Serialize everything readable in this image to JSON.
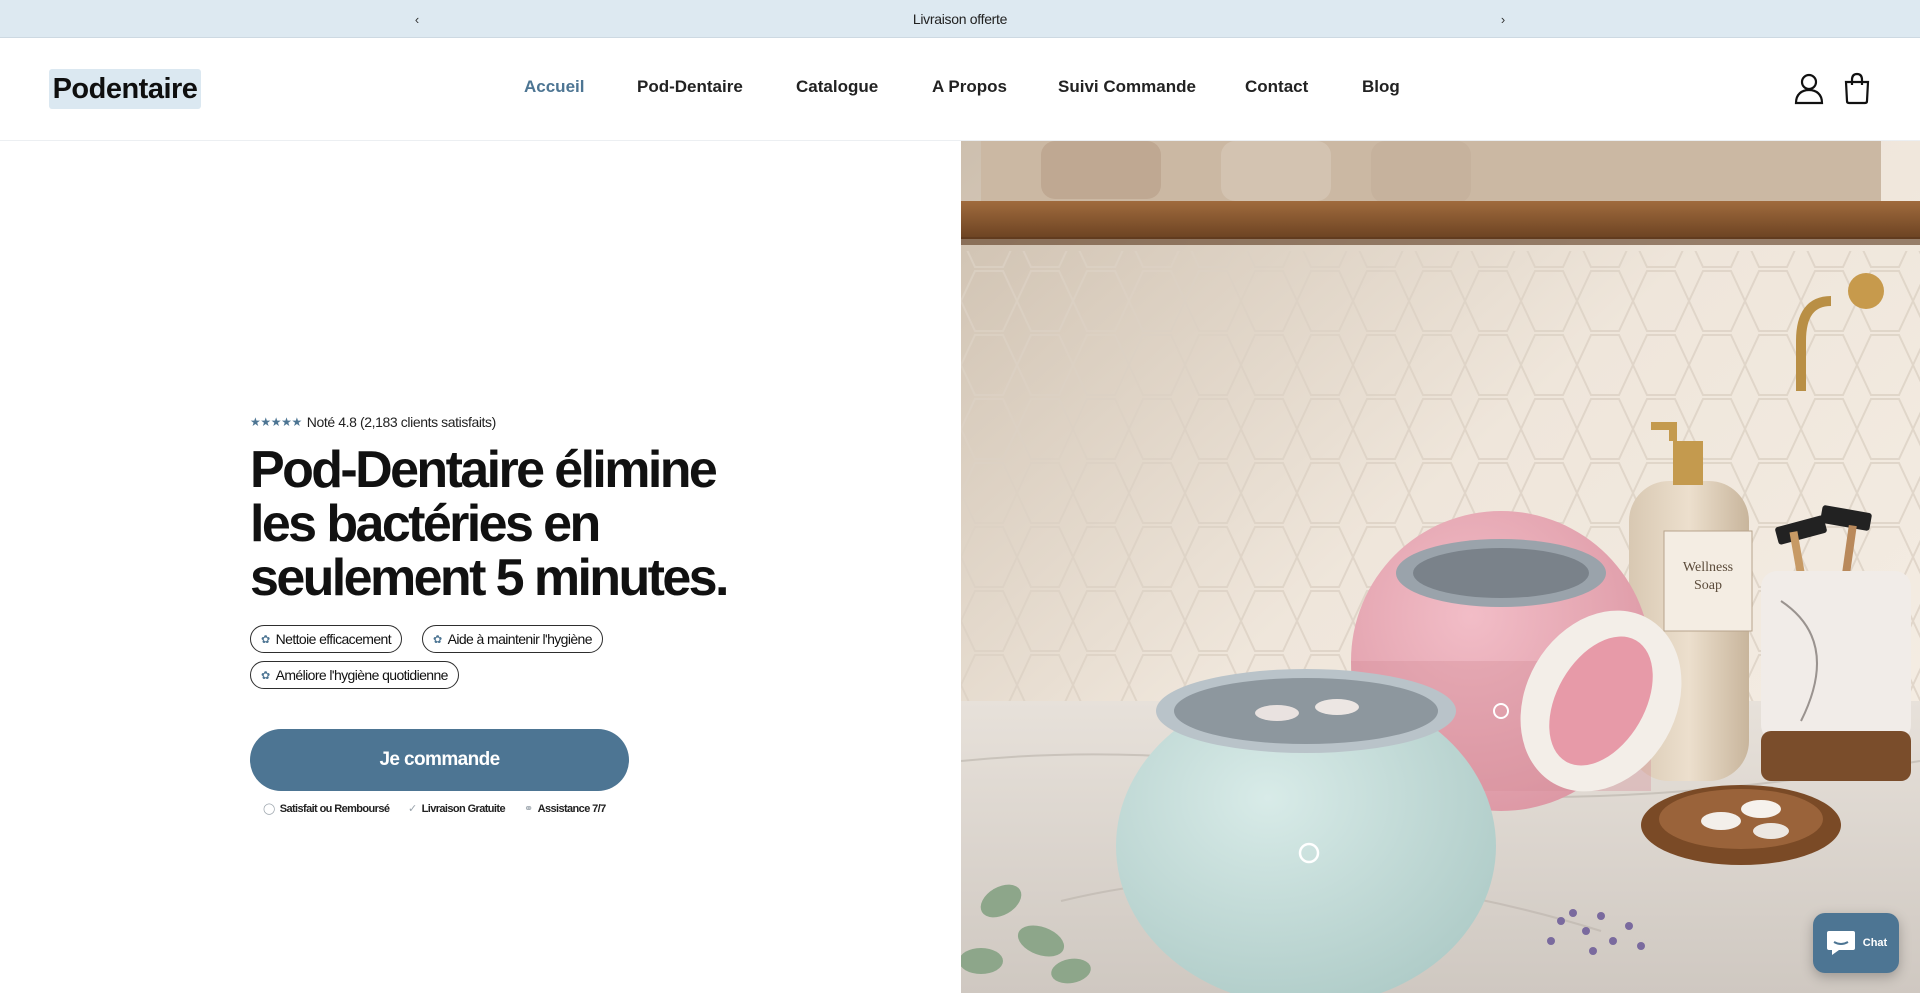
{
  "announcement": {
    "text": "Livraison offerte",
    "prev_icon": "chevron-left-icon",
    "next_icon": "chevron-right-icon"
  },
  "header": {
    "logo_text": "Podentaire",
    "nav": [
      {
        "label": "Accueil",
        "active": true
      },
      {
        "label": "Pod-Dentaire",
        "active": false
      },
      {
        "label": "Catalogue",
        "active": false
      },
      {
        "label": "A Propos",
        "active": false
      },
      {
        "label": "Suivi Commande",
        "active": false
      },
      {
        "label": "Contact",
        "active": false
      },
      {
        "label": "Blog",
        "active": false
      }
    ],
    "account_icon": "user-icon",
    "cart_icon": "shopping-bag-icon"
  },
  "hero": {
    "rating": {
      "stars": 5,
      "text": "Noté 4.8 (2,183 clients satisfaits)"
    },
    "headline": "Pod-Dentaire élimine les bactéries en seulement 5 minutes.",
    "features": [
      "Nettoie efficacement",
      "Aide à maintenir l'hygiène",
      "Améliore l'hygiène quotidienne"
    ],
    "cta_label": "Je commande",
    "trust": [
      {
        "icon": "shield-icon",
        "label": "Satisfait ou Remboursé"
      },
      {
        "icon": "check-icon",
        "label": "Livraison Gratuite"
      },
      {
        "icon": "headset-icon",
        "label": "Assistance 7/7"
      }
    ],
    "image_text": {
      "soap_label_line1": "Wellness",
      "soap_label_line2": "Soap"
    }
  },
  "chat": {
    "label": "Chat",
    "icon": "chat-bubble-icon"
  },
  "colors": {
    "accent": "#4d7593",
    "announcement_bg": "#dde9f1",
    "logo_bg": "#dbe8f1"
  }
}
